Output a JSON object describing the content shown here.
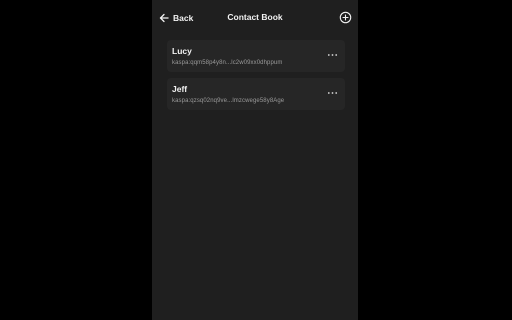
{
  "header": {
    "back_label": "Back",
    "title": "Contact Book",
    "back_icon": "arrow-left-icon",
    "add_icon": "plus-circle-icon"
  },
  "contacts": [
    {
      "name": "Lucy",
      "address": "kaspa:qqm58p4y8n...lc2w09xx0dhppum",
      "menu_icon": "more-horizontal-icon"
    },
    {
      "name": "Jeff",
      "address": "kaspa:qzsq02nq9ve...lmzcwege58y8Age",
      "menu_icon": "more-horizontal-icon"
    }
  ],
  "colors": {
    "background": "#000000",
    "panel": "#1f1f1f",
    "card": "#262626",
    "text_primary": "#f2f2f2",
    "text_secondary": "#9a9a9a"
  }
}
